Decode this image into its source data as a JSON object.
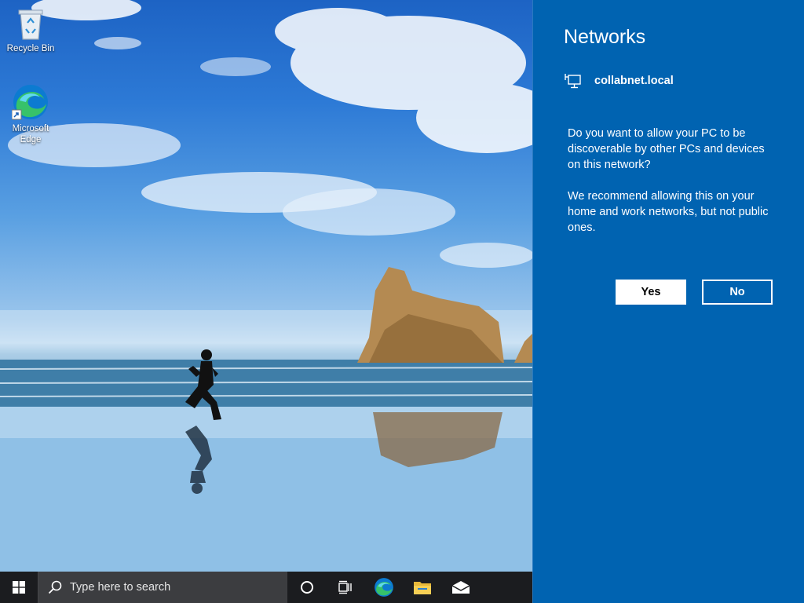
{
  "desktop": {
    "icons": [
      {
        "label": "Recycle Bin",
        "icon": "recycle-bin-icon"
      },
      {
        "label": "Microsoft Edge",
        "icon": "edge-icon"
      }
    ]
  },
  "taskbar": {
    "start_icon": "windows-logo-icon",
    "search_placeholder": "Type here to search",
    "buttons": [
      "cortana-icon",
      "task-view-icon",
      "edge-icon",
      "file-explorer-icon",
      "mail-icon"
    ]
  },
  "network_flyout": {
    "title": "Networks",
    "network_icon": "ethernet-icon",
    "network_name": "collabnet.local",
    "question": "Do you want to allow your PC to be discoverable by other PCs and devices on this network?",
    "recommendation": "We recommend allowing this on your home and work networks, but not public ones.",
    "yes_label": "Yes",
    "no_label": "No",
    "background_color": "#0063b1"
  }
}
